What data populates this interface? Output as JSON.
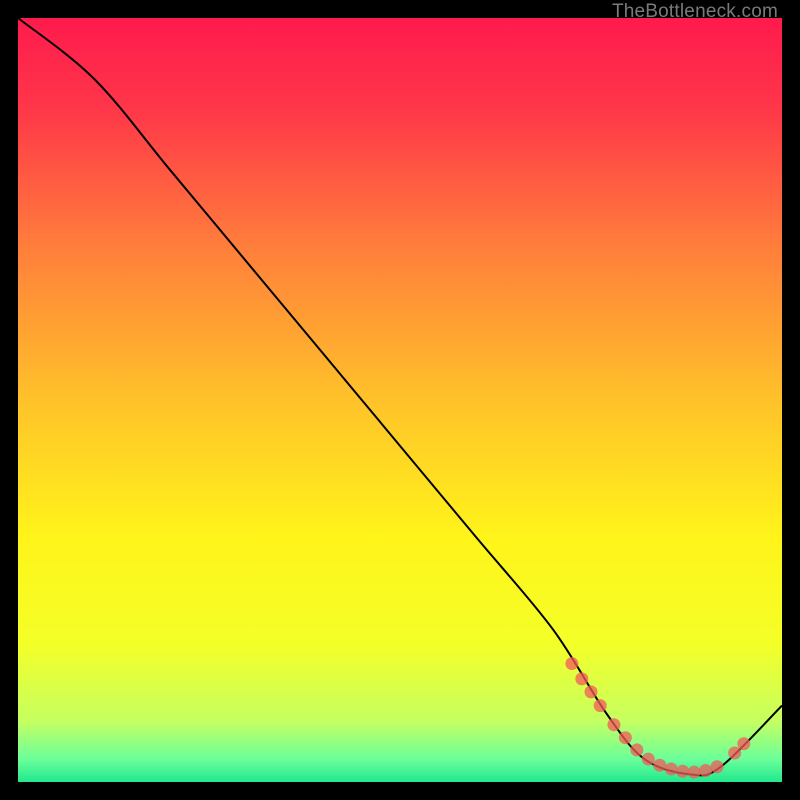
{
  "watermark": "TheBottleneck.com",
  "chart_data": {
    "type": "line",
    "title": "",
    "xlabel": "",
    "ylabel": "",
    "xlim": [
      0,
      100
    ],
    "ylim": [
      0,
      100
    ],
    "series": [
      {
        "name": "bottleneck-curve",
        "x": [
          0,
          10,
          20,
          30,
          40,
          50,
          60,
          70,
          77,
          82,
          88,
          92,
          100
        ],
        "y": [
          100,
          92,
          80,
          68,
          56,
          44,
          32,
          20,
          9,
          3,
          1,
          2,
          10
        ]
      }
    ],
    "markers": {
      "name": "highlighted-points",
      "x": [
        72.5,
        73.8,
        75.0,
        76.2,
        78.0,
        79.5,
        81.0,
        82.5,
        84.0,
        85.5,
        87.0,
        88.5,
        90.0,
        91.5,
        93.8,
        95.0
      ],
      "y": [
        15.5,
        13.5,
        11.8,
        10.0,
        7.5,
        5.8,
        4.2,
        3.0,
        2.2,
        1.7,
        1.4,
        1.3,
        1.5,
        2.0,
        3.8,
        5.0
      ]
    },
    "gradient_stops": [
      {
        "offset": 0.0,
        "color": "#ff1a4d"
      },
      {
        "offset": 0.12,
        "color": "#ff3749"
      },
      {
        "offset": 0.3,
        "color": "#ff7e3b"
      },
      {
        "offset": 0.5,
        "color": "#ffc22a"
      },
      {
        "offset": 0.68,
        "color": "#fff41a"
      },
      {
        "offset": 0.82,
        "color": "#f4ff28"
      },
      {
        "offset": 0.92,
        "color": "#c5ff60"
      },
      {
        "offset": 0.97,
        "color": "#6bff9a"
      },
      {
        "offset": 1.0,
        "color": "#22e88f"
      }
    ],
    "curve_color": "#000000",
    "marker_color": "#f45a5a"
  }
}
